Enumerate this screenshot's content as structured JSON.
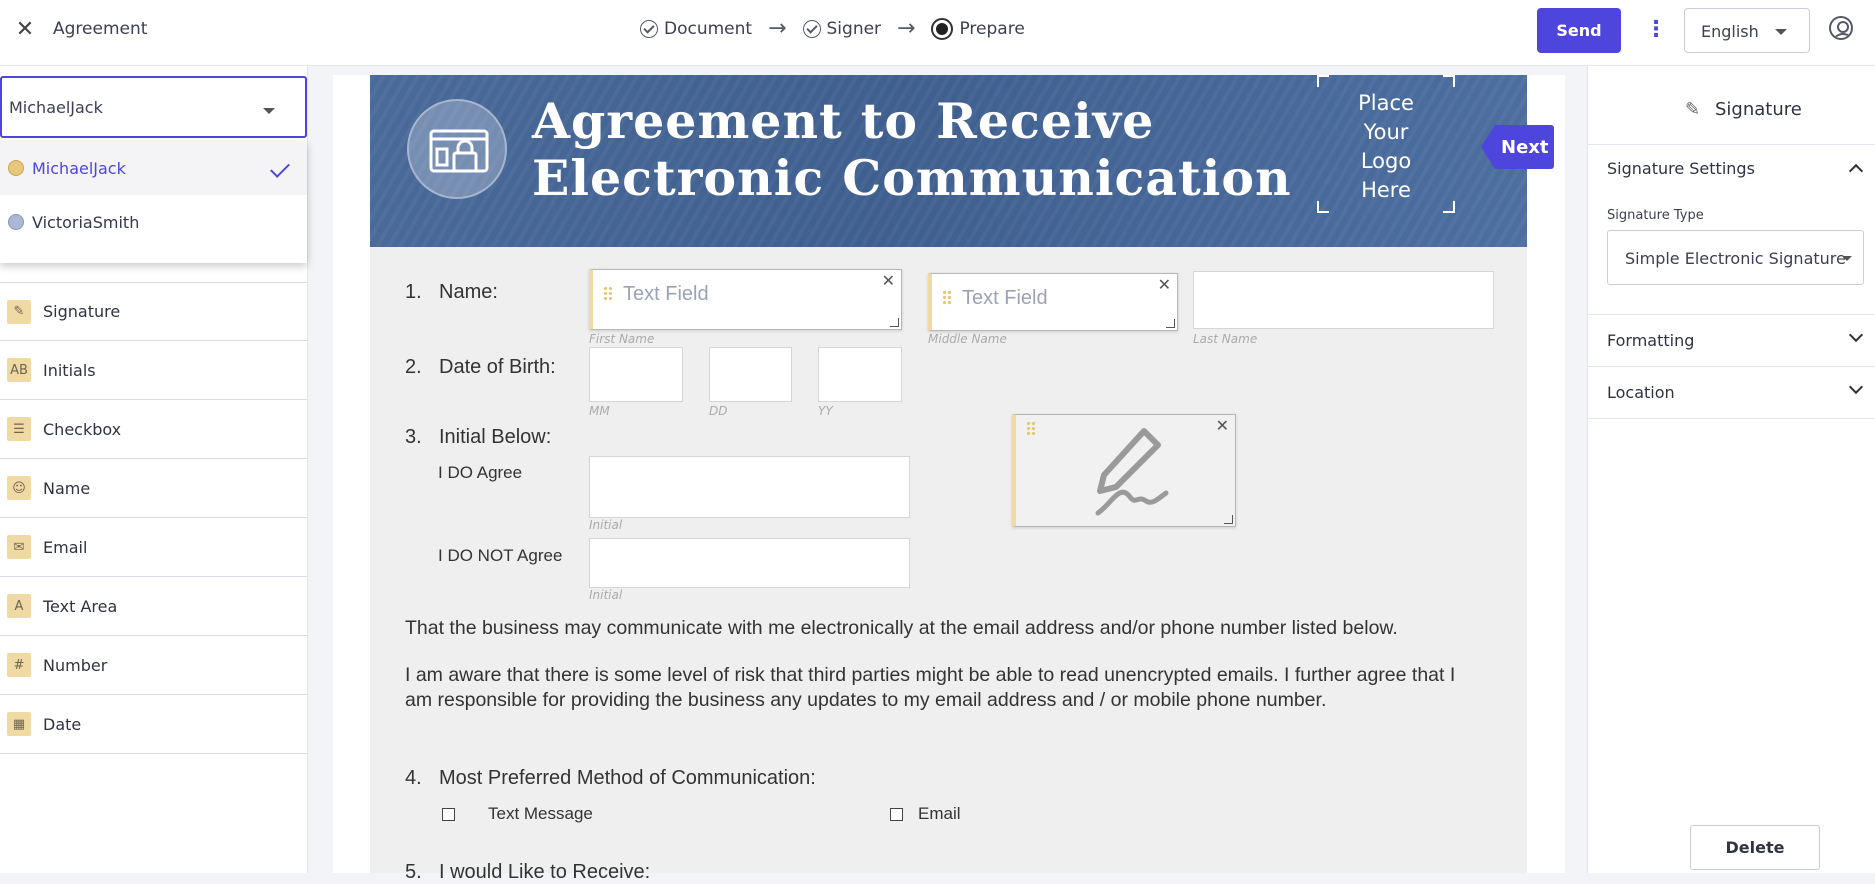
{
  "topbar": {
    "title": "Agreement",
    "steps": [
      "Document",
      "Signer",
      "Prepare"
    ],
    "send_label": "Send",
    "language": "English"
  },
  "left": {
    "selected_signer": "MichaelJack",
    "signers": [
      {
        "name": "MichaelJack",
        "color": "#e9c77a"
      },
      {
        "name": "VictoriaSmith",
        "color": "#a9b8d4"
      }
    ],
    "tools": [
      {
        "label": "Signature",
        "icon": "pen-icon"
      },
      {
        "label": "Initials",
        "icon": "initials-icon"
      },
      {
        "label": "Checkbox",
        "icon": "checkbox-icon"
      },
      {
        "label": "Name",
        "icon": "person-icon"
      },
      {
        "label": "Email",
        "icon": "envelope-icon"
      },
      {
        "label": "Text Area",
        "icon": "text-area-icon"
      },
      {
        "label": "Number",
        "icon": "number-icon"
      },
      {
        "label": "Date",
        "icon": "calendar-icon"
      }
    ]
  },
  "doc": {
    "header_line1": "Agreement to Receive",
    "header_line2": "Electronic Communication",
    "logo_text": [
      "Place",
      "Your",
      "Logo",
      "Here"
    ],
    "next_label": "Next",
    "q1_num": "1.",
    "q1": "Name:",
    "q2_num": "2.",
    "q2": "Date of Birth:",
    "q3_num": "3.",
    "q3": "Initial Below:",
    "q4_num": "4.",
    "q4": "Most Preferred Method of Communication:",
    "q5_num": "5.",
    "q5": "I would Like to Receive:",
    "field_placeholder": "Text Field",
    "cap_first": "First Name",
    "cap_middle": "Middle Name",
    "cap_last": "Last Name",
    "cap_mm": "MM",
    "cap_dd": "DD",
    "cap_yy": "YY",
    "cap_initial": "Initial",
    "agree": "I DO Agree",
    "not_agree": "I DO NOT Agree",
    "para1": "That the business may communicate with me electronically at the email address and/or phone number listed below.",
    "para2": "I am aware that there is some level of risk that third parties might be able to read unencrypted emails. I further agree that I am responsible for providing the business any updates to my email address and / or mobile phone number.",
    "opt_text": "Text Message",
    "opt_email": "Email"
  },
  "right": {
    "title": "Signature",
    "settings": "Signature Settings",
    "type_label": "Signature Type",
    "type_value": "Simple Electronic Signature",
    "formatting": "Formatting",
    "location": "Location",
    "delete": "Delete"
  }
}
